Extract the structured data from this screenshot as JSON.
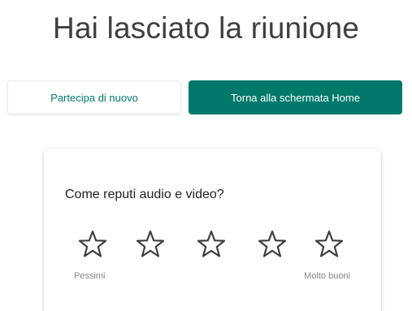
{
  "header": {
    "title": "Hai lasciato la riunione"
  },
  "actions": {
    "rejoin_label": "Partecipa di nuovo",
    "home_label": "Torna alla schermata Home"
  },
  "feedback": {
    "question": "Come reputi audio e video?",
    "rating_max": 5,
    "rating_selected": 0,
    "min_label": "Pessimi",
    "max_label": "Molto buoni"
  },
  "colors": {
    "accent": "#00796b",
    "title_text": "#3c4043",
    "star_outline": "#3c4043"
  },
  "icons": {
    "rating_star": "star-outline-icon"
  }
}
